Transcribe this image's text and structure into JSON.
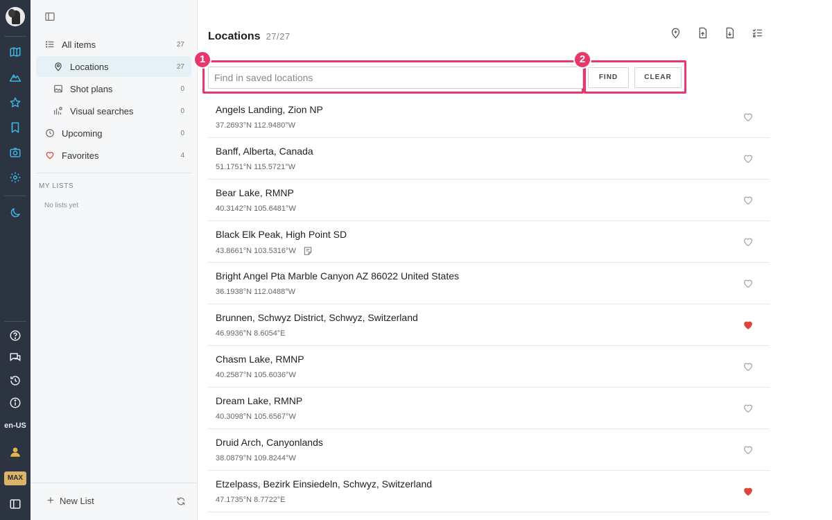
{
  "rail": {
    "icons": [
      "map-icon",
      "mountains-icon",
      "star-icon",
      "bookmark-icon",
      "camera-icon",
      "settings-icon",
      "moon-icon",
      "help-icon",
      "chat-icon",
      "history-icon",
      "info-icon",
      "user-icon",
      "panel-icon"
    ],
    "locale": "en-US",
    "plan_badge": "MAX"
  },
  "sidebar": {
    "items": [
      {
        "label": "All items",
        "count": "27",
        "icon": "list-icon"
      },
      {
        "label": "Locations",
        "count": "27",
        "icon": "pin-icon"
      },
      {
        "label": "Shot plans",
        "count": "0",
        "icon": "image-icon"
      },
      {
        "label": "Visual searches",
        "count": "0",
        "icon": "visual-search-icon"
      },
      {
        "label": "Upcoming",
        "count": "0",
        "icon": "clock-icon"
      },
      {
        "label": "Favorites",
        "count": "4",
        "icon": "heart-icon"
      }
    ],
    "section_title": "MY LISTS",
    "empty_text": "No lists yet",
    "new_list_label": "New List"
  },
  "main": {
    "title": "Locations",
    "count": "27/27",
    "toolbar": [
      "add-location-icon",
      "upload-file-icon",
      "download-file-icon",
      "checklist-icon"
    ],
    "search": {
      "placeholder": "Find in saved locations",
      "value": ""
    },
    "find_label": "FIND",
    "clear_label": "CLEAR",
    "markers": [
      "1",
      "2"
    ],
    "locations": [
      {
        "name": "Angels Landing, Zion NP",
        "coords": "37.2693°N 112.9480°W",
        "favorite": false,
        "note": false
      },
      {
        "name": "Banff, Alberta, Canada",
        "coords": "51.1751°N 115.5721°W",
        "favorite": false,
        "note": false
      },
      {
        "name": "Bear Lake, RMNP",
        "coords": "40.3142°N 105.6481°W",
        "favorite": false,
        "note": false
      },
      {
        "name": "Black Elk Peak, High Point SD",
        "coords": "43.8661°N 103.5316°W",
        "favorite": false,
        "note": true
      },
      {
        "name": "Bright Angel Pta Marble Canyon AZ 86022 United States",
        "coords": "36.1938°N 112.0488°W",
        "favorite": false,
        "note": false
      },
      {
        "name": "Brunnen, Schwyz District, Schwyz, Switzerland",
        "coords": "46.9936°N 8.6054°E",
        "favorite": true,
        "note": false
      },
      {
        "name": "Chasm Lake, RMNP",
        "coords": "40.2587°N 105.6036°W",
        "favorite": false,
        "note": false
      },
      {
        "name": "Dream Lake, RMNP",
        "coords": "40.3098°N 105.6567°W",
        "favorite": false,
        "note": false
      },
      {
        "name": "Druid Arch, Canyonlands",
        "coords": "38.0879°N 109.8244°W",
        "favorite": false,
        "note": false
      },
      {
        "name": "Etzelpass, Bezirk Einsiedeln, Schwyz, Switzerland",
        "coords": "47.1735°N 8.7722°E",
        "favorite": true,
        "note": false
      }
    ]
  },
  "colors": {
    "rail_bg": "#2b3440",
    "rail_icon": "#3fb4e6",
    "highlight": "#e8376a",
    "heart_fav": "#e0453a",
    "active_item_bg": "#e6f0f7"
  }
}
